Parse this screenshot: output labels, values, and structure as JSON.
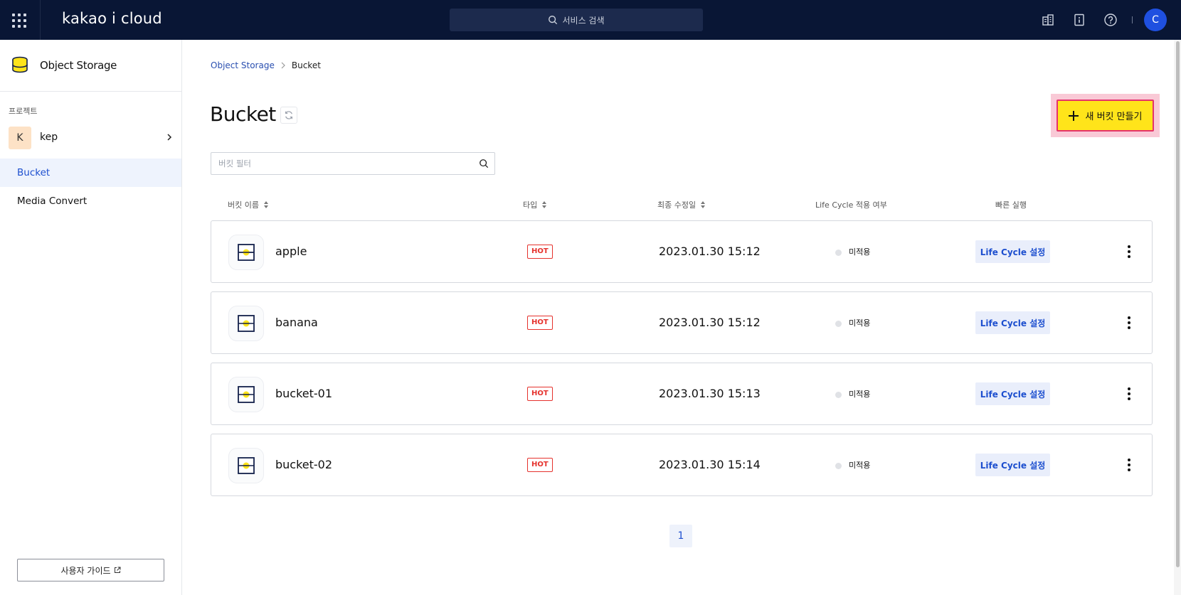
{
  "topbar": {
    "logo": "kakao i cloud",
    "search_placeholder": "서비스 검색",
    "avatar_initial": "C"
  },
  "sidebar": {
    "service_title": "Object Storage",
    "project_label": "프로젝트",
    "project": {
      "initial": "K",
      "name": "kep"
    },
    "items": [
      {
        "label": "Bucket",
        "active": true
      },
      {
        "label": "Media Convert",
        "active": false
      }
    ],
    "guide_button": "사용자 가이드"
  },
  "breadcrumb": {
    "root": "Object Storage",
    "current": "Bucket"
  },
  "page": {
    "title": "Bucket",
    "create_button": "새 버킷 만들기",
    "filter_placeholder": "버킷 필터"
  },
  "table": {
    "headers": {
      "name": "버킷 이름",
      "type": "타입",
      "modified": "최종 수정일",
      "lifecycle": "Life Cycle 적용 여부",
      "actions": "빠른 실행"
    },
    "rows": [
      {
        "name": "apple",
        "type": "HOT",
        "modified": "2023.01.30 15:12",
        "lifecycle": "미적용",
        "action": "Life Cycle 설정"
      },
      {
        "name": "banana",
        "type": "HOT",
        "modified": "2023.01.30 15:12",
        "lifecycle": "미적용",
        "action": "Life Cycle 설정"
      },
      {
        "name": "bucket-01",
        "type": "HOT",
        "modified": "2023.01.30 15:13",
        "lifecycle": "미적용",
        "action": "Life Cycle 설정"
      },
      {
        "name": "bucket-02",
        "type": "HOT",
        "modified": "2023.01.30 15:14",
        "lifecycle": "미적용",
        "action": "Life Cycle 설정"
      }
    ]
  },
  "pagination": {
    "current": "1"
  },
  "colors": {
    "topbar": "#091635",
    "accent_blue": "#1d4fcf",
    "create_button": "#ffe41a",
    "hot_badge": "#e5322d"
  }
}
